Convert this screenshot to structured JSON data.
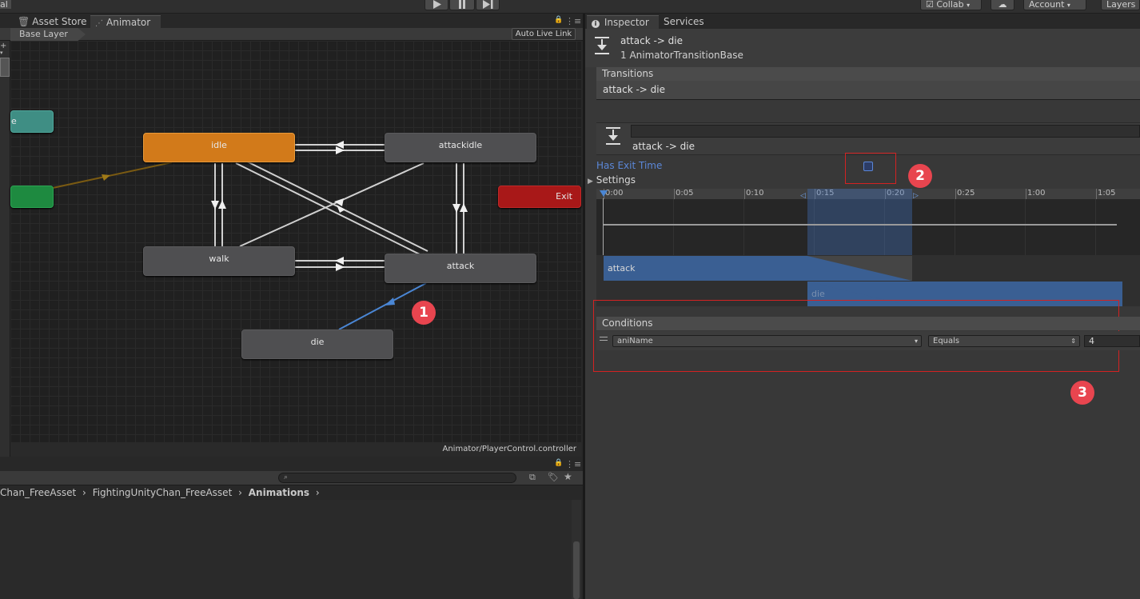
{
  "topbar": {
    "left_label": "al",
    "collab": "Collab",
    "account": "Account",
    "layers": "Layers"
  },
  "left_tabs": {
    "asset_store": "Asset Store",
    "animator": "Animator"
  },
  "animator": {
    "breadcrumb": "Base Layer",
    "auto_live_link": "Auto Live Link",
    "footer_path": "Animator/PlayerControl.controller",
    "nodes": {
      "idle": "idle",
      "attackidle": "attackidle",
      "walk": "walk",
      "attack": "attack",
      "die": "die",
      "exit": "Exit",
      "partial_teal": "e"
    }
  },
  "project": {
    "breadcrumb": [
      "Chan_FreeAsset",
      "FightingUnityChan_FreeAsset",
      "Animations"
    ]
  },
  "right_tabs": {
    "inspector": "Inspector",
    "services": "Services"
  },
  "inspector": {
    "title": "attack -> die",
    "subtitle": "1 AnimatorTransitionBase",
    "transitions_header": "Transitions",
    "transition_item": "attack -> die",
    "detail_title": "attack -> die",
    "has_exit_time_label": "Has Exit Time",
    "has_exit_time_checked": false,
    "settings_label": "Settings",
    "timeline_ticks": [
      "0:00",
      "0:05",
      "0:10",
      "0:15",
      "0:20",
      "0:25",
      "1:00",
      "1:05"
    ],
    "clip_from": "attack",
    "clip_to": "die",
    "conditions_header": "Conditions",
    "condition": {
      "parameter": "aniName",
      "mode": "Equals",
      "value": "4"
    }
  },
  "annotations": [
    "1",
    "2",
    "3"
  ],
  "colors": {
    "idle_node": "#d27a1a",
    "exit_node": "#a81818",
    "entry_node": "#1e8a40",
    "any_state_node": "#3f8e84",
    "selected_transition": "#4a86d4",
    "annotation": "#e8454f"
  }
}
